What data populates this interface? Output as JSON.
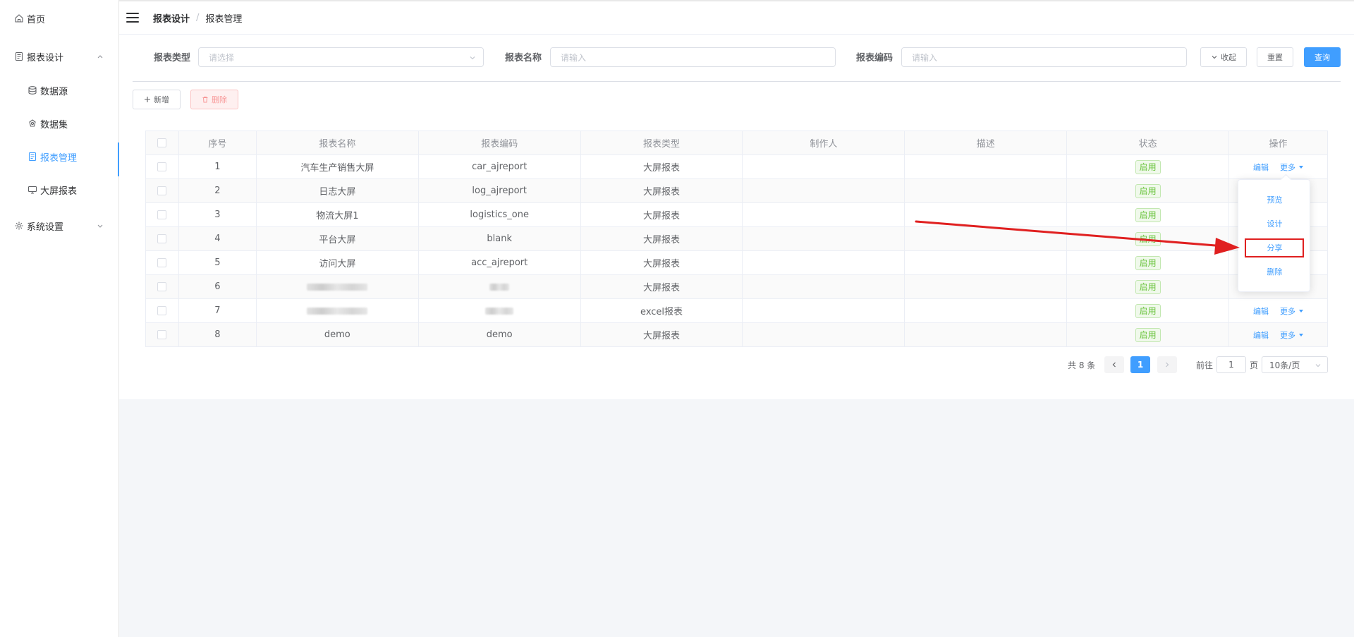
{
  "sidebar": {
    "items": [
      {
        "label": "首页",
        "icon": "home-icon"
      },
      {
        "label": "报表设计",
        "icon": "report-design-icon",
        "expanded": true
      },
      {
        "label": "数据源",
        "icon": "database-icon"
      },
      {
        "label": "数据集",
        "icon": "dataset-icon"
      },
      {
        "label": "报表管理",
        "icon": "report-manage-icon",
        "active": true
      },
      {
        "label": "大屏报表",
        "icon": "monitor-icon"
      },
      {
        "label": "系统设置",
        "icon": "gear-icon",
        "expanded": false
      }
    ]
  },
  "breadcrumb": {
    "level1": "报表设计",
    "separator": "/",
    "level2": "报表管理"
  },
  "filters": {
    "type_label": "报表类型",
    "type_placeholder": "请选择",
    "name_label": "报表名称",
    "name_placeholder": "请输入",
    "code_label": "报表编码",
    "code_placeholder": "请输入",
    "collapse_label": "收起",
    "reset_label": "重置",
    "query_label": "查询"
  },
  "toolbar": {
    "add_label": "新增",
    "delete_label": "删除"
  },
  "table": {
    "headers": [
      "序号",
      "报表名称",
      "报表编码",
      "报表类型",
      "制作人",
      "描述",
      "状态",
      "操作"
    ],
    "rows": [
      {
        "no": "1",
        "name": "汽车生产销售大屏",
        "code": "car_ajreport",
        "type": "大屏报表",
        "status": "启用"
      },
      {
        "no": "2",
        "name": "日志大屏",
        "code": "log_ajreport",
        "type": "大屏报表",
        "status": "启用"
      },
      {
        "no": "3",
        "name": "物流大屏1",
        "code": "logistics_one",
        "type": "大屏报表",
        "status": "启用"
      },
      {
        "no": "4",
        "name": "平台大屏",
        "code": "blank",
        "type": "大屏报表",
        "status": "启用"
      },
      {
        "no": "5",
        "name": "访问大屏",
        "code": "acc_ajreport",
        "type": "大屏报表",
        "status": "启用"
      },
      {
        "no": "6",
        "name": "",
        "code": "",
        "type": "大屏报表",
        "status": "启用"
      },
      {
        "no": "7",
        "name": "",
        "code": "",
        "type": "excel报表",
        "status": "启用"
      },
      {
        "no": "8",
        "name": "demo",
        "code": "demo",
        "type": "大屏报表",
        "status": "启用"
      }
    ],
    "edit_label": "编辑",
    "more_label": "更多"
  },
  "dropdown": {
    "items": [
      "预览",
      "设计",
      "分享",
      "删除"
    ],
    "highlighted": "分享"
  },
  "pagination": {
    "total": "共 8 条",
    "current_page": "1",
    "goto_label": "前往",
    "goto_value": "1",
    "page_suffix": "页",
    "page_size": "10条/页"
  },
  "colors": {
    "primary": "#409eff",
    "success": "#67c23a",
    "annotation": "#e02020"
  }
}
